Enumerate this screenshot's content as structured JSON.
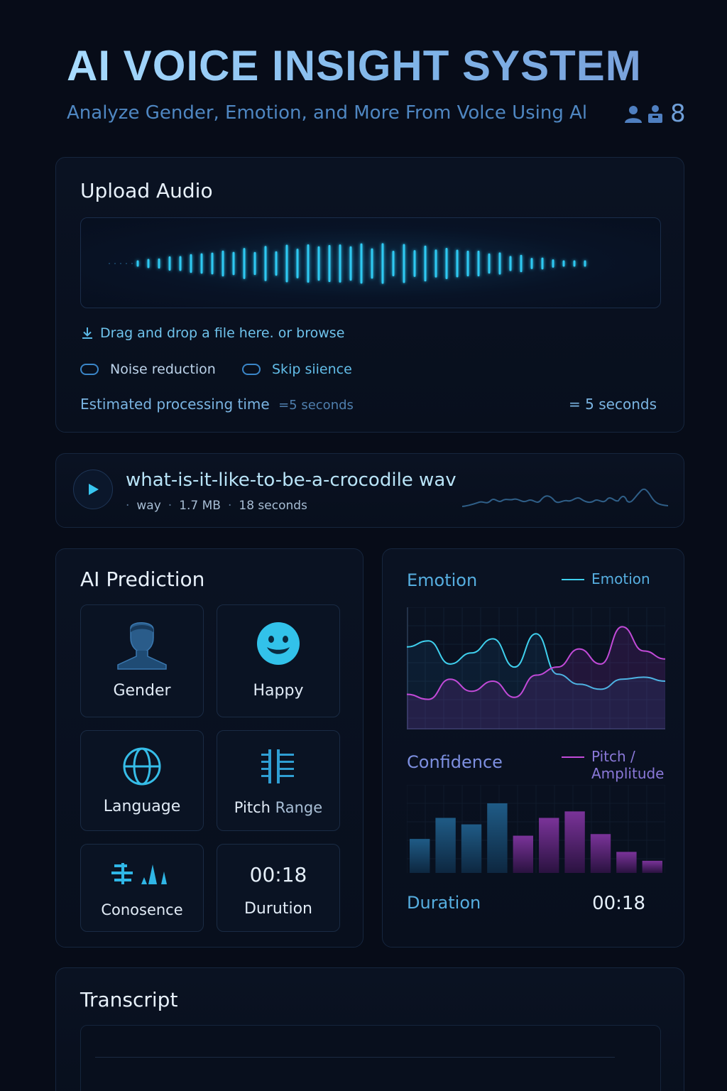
{
  "header": {
    "title": "AI VOICE INSIGHT SYSTEM",
    "subtitle": "Analyze Gender, Emotion, and More From Volce Using Al",
    "user_count": "8",
    "icons": [
      "user-icon",
      "user-badge-icon"
    ]
  },
  "upload": {
    "title": "Upload Audio",
    "drop_text": "Drag and drop a file here. or browse",
    "toggles": [
      {
        "label": "Noise reduction",
        "color": "#bcd3ea"
      },
      {
        "label": "Skip siience",
        "color": "#62bde8"
      }
    ],
    "estimate_label": "Estimated processing time",
    "estimate_small": "=5 seconds",
    "estimate_right": "= 5 seconds"
  },
  "file": {
    "name": "what-is-it-like-to-be-a-crocodile wav",
    "format": "way",
    "size": "1.7 MB",
    "duration": "18 seconds"
  },
  "prediction": {
    "title": "AI Prediction",
    "tiles": {
      "gender": "Gender",
      "happy": "Happy",
      "language": "Language",
      "pitch_a": "Pitch",
      "pitch_b": "Range",
      "confidence": "Conosence",
      "duration_value": "00:18",
      "duration_label": "Durution"
    }
  },
  "emotion_panel": {
    "emotion_label": "Emotion",
    "emotion_legend": "Emotion",
    "confidence_label": "Confidence",
    "pitch_legend_line1": "Pitch /",
    "pitch_legend_line2": "Amplitude",
    "duration_label": "Duration",
    "duration_value": "00:18",
    "colors": {
      "cyan": "#3fd0ee",
      "magenta": "#c24ad8",
      "bar_blue": "#1b4f78",
      "bar_purple": "#6a2f8e"
    }
  },
  "chart_data": [
    {
      "type": "line",
      "series": [
        {
          "name": "Emotion",
          "values": [
            0.72,
            0.78,
            0.55,
            0.66,
            0.8,
            0.52,
            0.85,
            0.45,
            0.35,
            0.3,
            0.4,
            0.42,
            0.38
          ]
        },
        {
          "values": [
            0.25,
            0.2,
            0.4,
            0.28,
            0.38,
            0.22,
            0.44,
            0.52,
            0.7,
            0.55,
            0.92,
            0.68,
            0.6
          ]
        }
      ],
      "grid": true
    },
    {
      "type": "bar",
      "values": [
        0.42,
        0.68,
        0.6,
        0.86,
        0.46,
        0.68,
        0.76,
        0.48,
        0.26,
        0.15
      ],
      "series_colors": [
        "blue",
        "blue",
        "blue",
        "blue",
        "purple",
        "purple",
        "purple",
        "purple",
        "purple",
        "purple"
      ],
      "grid": true
    }
  ],
  "transcript": {
    "title": "Transcript"
  }
}
